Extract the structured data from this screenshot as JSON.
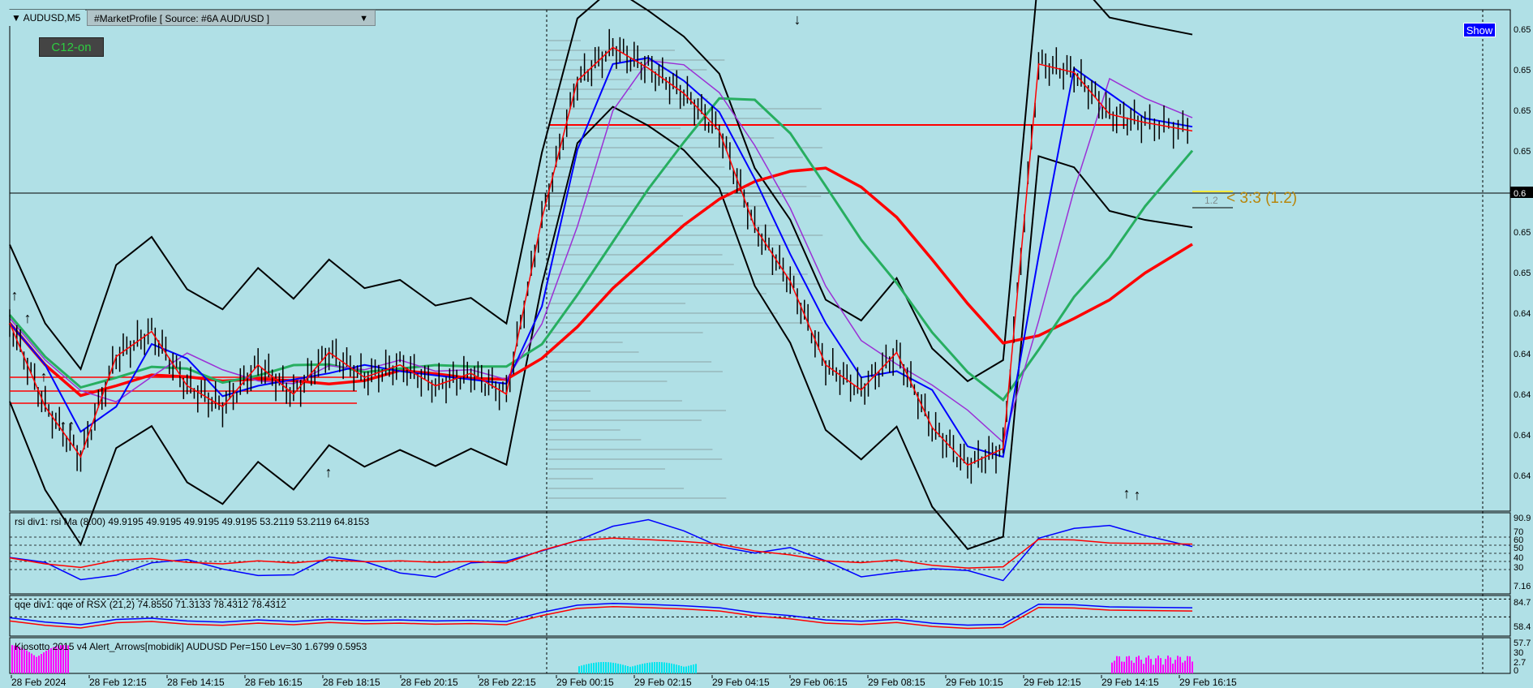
{
  "window": {
    "symbol": "AUDUSD,M5",
    "indicator": "#MarketProfile [ Source: #6A AUD/USD ]",
    "c12_label": "C12-on",
    "show_label": "Show"
  },
  "colors": {
    "background": "#b0e0e6",
    "candle": "#000000",
    "ma_red": "#ff0000",
    "ma_green": "#27ae60",
    "ma_blue": "#0000ff",
    "envelope_purple": "#9b30d6",
    "histogram_magenta": "#ff00ff",
    "histogram_cyan": "#00e5ee",
    "label_gold": "#b8860b"
  },
  "chart_data": [
    {
      "type": "line",
      "name": "price",
      "x_labels": [
        "28 Feb 2024",
        "28 Feb 12:15",
        "28 Feb 14:15",
        "28 Feb 16:15",
        "28 Feb 18:15",
        "28 Feb 20:15",
        "28 Feb 22:15",
        "29 Feb 00:15",
        "29 Feb 02:15",
        "29 Feb 04:15",
        "29 Feb 06:15",
        "29 Feb 08:15",
        "29 Feb 10:15",
        "29 Feb 12:15",
        "29 Feb 14:15",
        "29 Feb 16:15"
      ],
      "price_index": [
        0.0,
        0.03,
        0.06,
        0.09,
        0.12,
        0.15,
        0.18,
        0.21,
        0.24,
        0.27,
        0.3,
        0.33,
        0.36,
        0.39,
        0.42,
        0.45,
        0.48,
        0.51,
        0.54,
        0.57,
        0.6,
        0.63,
        0.66,
        0.69,
        0.72,
        0.75,
        0.78,
        0.81,
        0.84,
        0.87,
        0.9,
        0.93,
        0.96,
        1.0
      ],
      "price": [
        0.651,
        0.649,
        0.6478,
        0.6502,
        0.6508,
        0.6495,
        0.649,
        0.65,
        0.6493,
        0.6503,
        0.6497,
        0.65,
        0.6495,
        0.6498,
        0.6493,
        0.6535,
        0.6568,
        0.6576,
        0.6571,
        0.6565,
        0.6556,
        0.6533,
        0.652,
        0.65,
        0.6494,
        0.6503,
        0.6485,
        0.6476,
        0.648,
        0.6572,
        0.657,
        0.656,
        0.6558,
        0.6556
      ],
      "y_axis_labels": [
        "0.65",
        "0.65",
        "0.65",
        "0.65",
        "0.65",
        "0.65",
        "0.65",
        "0.64",
        "0.64",
        "0.64",
        "0.64",
        "0.64"
      ],
      "current_price_label": "0.6",
      "annotation": "< 3:3 (1.2)",
      "annotation_small": "1.2"
    },
    {
      "type": "line",
      "name": "rsi",
      "label": "rsi div1: rsi Ma (8.00) 49.9195 49.9195 49.9195 49.9195 53.2119 53.2119 64.8153",
      "y_axis_labels": [
        "90.9",
        "70",
        "60",
        "50",
        "40",
        "30",
        "7.16"
      ]
    },
    {
      "type": "line",
      "name": "qqe",
      "label": "qqe div1: qqe of RSX (21,2) 74.8550 71.3133 78.4312 78.4312",
      "y_axis_labels": [
        "84.7",
        "58.4"
      ]
    },
    {
      "type": "bar",
      "name": "kiosotto",
      "label": "Kiosotto 2015 v4 Alert_Arrows[mobidik] AUDUSD Per=150 Lev=30 1.6799 0.5953",
      "y_axis_labels": [
        "57.7",
        "30",
        "2.7",
        "0"
      ]
    }
  ]
}
